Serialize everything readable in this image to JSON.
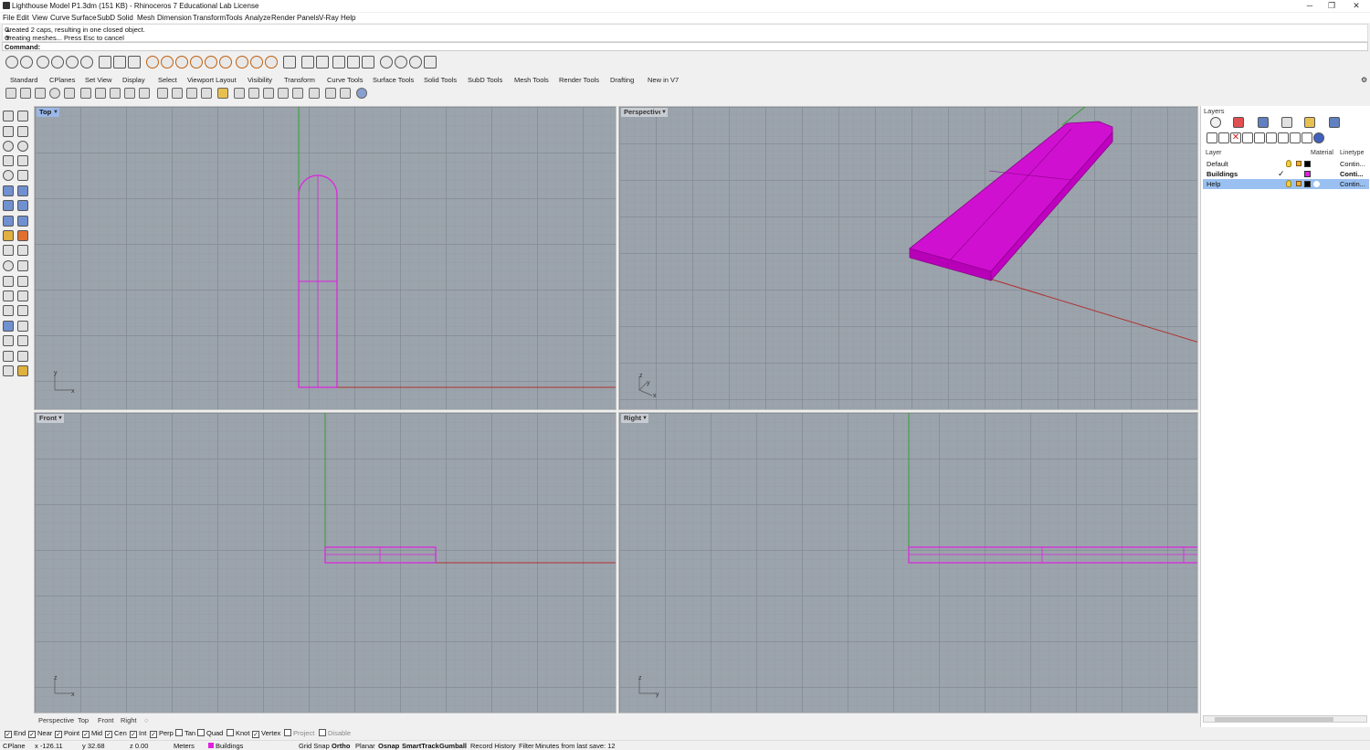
{
  "window": {
    "title": "Lighthouse Model P1.3dm (151 KB) - Rhinoceros 7 Educational Lab License",
    "minimize": "─",
    "restore": "❐",
    "close": "✕"
  },
  "menu": [
    "File",
    "Edit",
    "View",
    "Curve",
    "Surface",
    "SubD",
    "Solid",
    "Mesh",
    "Dimension",
    "Transform",
    "Tools",
    "Analyze",
    "Render",
    "Panels",
    "V-Ray",
    "Help"
  ],
  "command": {
    "history": [
      "Created 2 caps, resulting in one closed object.",
      "Creating meshes... Press Esc to cancel"
    ],
    "prompt": "Command:"
  },
  "tabs": [
    "Standard",
    "CPlanes",
    "Set View",
    "Display",
    "Select",
    "Viewport Layout",
    "Visibility",
    "Transform",
    "Curve Tools",
    "Surface Tools",
    "Solid Tools",
    "SubD Tools",
    "Mesh Tools",
    "Render Tools",
    "Drafting",
    "New in V7"
  ],
  "viewports": {
    "top": {
      "label": "Top",
      "axis_y": "y",
      "axis_x": "x"
    },
    "perspective": {
      "label": "Perspective",
      "axis_z": "z",
      "axis_y": "y",
      "axis_x": "x"
    },
    "front": {
      "label": "Front",
      "axis_z": "z",
      "axis_x": "x"
    },
    "right": {
      "label": "Right",
      "axis_z": "z",
      "axis_y": "y"
    }
  },
  "viewport_tabs": [
    "Perspective",
    "Top",
    "Front",
    "Right"
  ],
  "osnaps": [
    {
      "label": "End",
      "checked": true
    },
    {
      "label": "Near",
      "checked": true
    },
    {
      "label": "Point",
      "checked": true
    },
    {
      "label": "Mid",
      "checked": true
    },
    {
      "label": "Cen",
      "checked": true
    },
    {
      "label": "Int",
      "checked": true
    },
    {
      "label": "Perp",
      "checked": true
    },
    {
      "label": "Tan",
      "checked": false
    },
    {
      "label": "Quad",
      "checked": false
    },
    {
      "label": "Knot",
      "checked": false
    },
    {
      "label": "Vertex",
      "checked": true
    },
    {
      "label": "Project",
      "checked": false
    },
    {
      "label": "Disable",
      "checked": false
    }
  ],
  "status": {
    "cplane": "CPlane",
    "x": "x -126.11",
    "y": "y 32.68",
    "z": "z 0.00",
    "units": "Meters",
    "layer": "Buildings",
    "layer_color": "#e020e0",
    "grid_snap": "Grid Snap",
    "ortho": "Ortho",
    "planar": "Planar",
    "osnap": "Osnap",
    "smarttrack": "SmartTrack",
    "gumball": "Gumball",
    "record_history": "Record History",
    "filter": "Filter",
    "save_info": "Minutes from last save: 12"
  },
  "layers": {
    "title": "Layers",
    "columns": {
      "layer": "Layer",
      "material": "Material",
      "linetype": "Linetype"
    },
    "rows": [
      {
        "name": "Default",
        "color": "#000000",
        "linetype": "Contin...",
        "current": false,
        "selected": false,
        "bold": false
      },
      {
        "name": "Buildings",
        "color": "#e020e0",
        "linetype": "Conti...",
        "current": true,
        "selected": false,
        "bold": true
      },
      {
        "name": "Help",
        "color": "#000000",
        "linetype": "Contin...",
        "current": false,
        "selected": true,
        "bold": false
      }
    ],
    "current_mark": "✓"
  },
  "colors": {
    "object": "#e020e0",
    "x_axis": "#b03030",
    "y_axis": "#30a030",
    "viewport_bg": "#9ba3ac"
  }
}
